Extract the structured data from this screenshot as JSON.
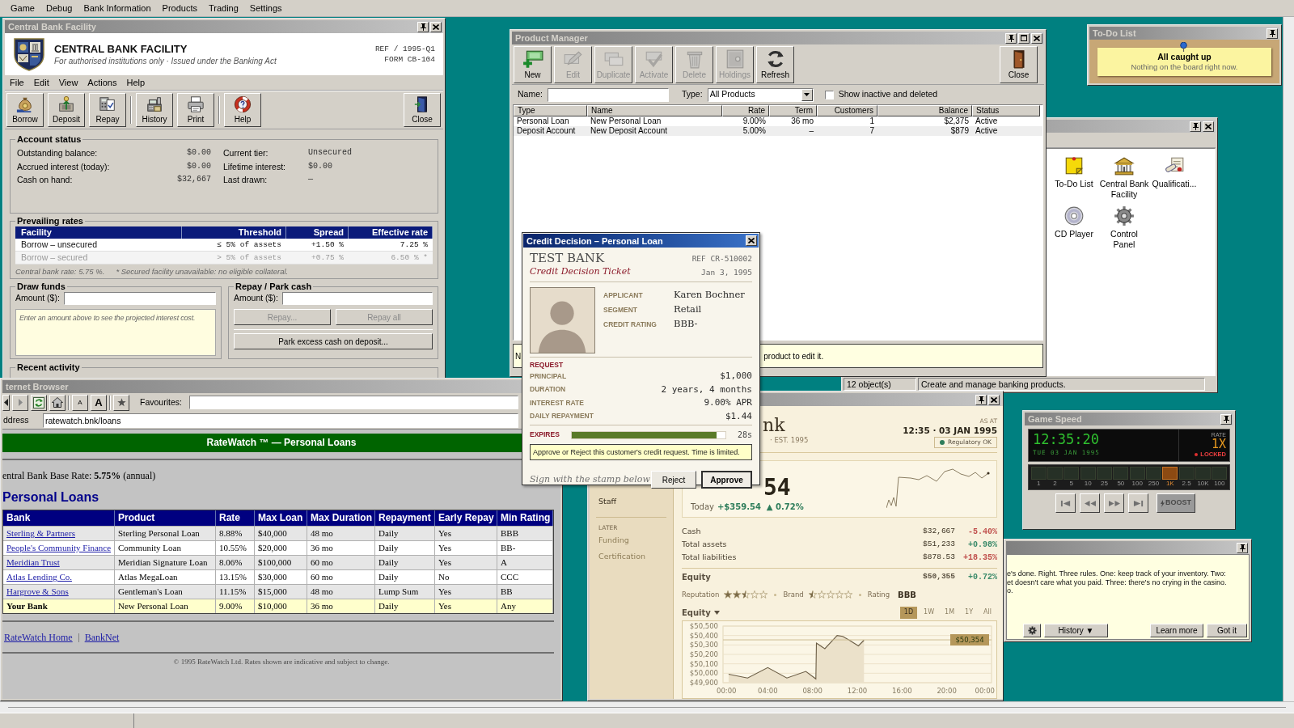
{
  "menu_bar": {
    "items": [
      "Game",
      "Debug",
      "Bank Information",
      "Products",
      "Trading",
      "Settings"
    ]
  },
  "central_bank": {
    "title": "Central Bank Facility",
    "heading": "CENTRAL BANK FACILITY",
    "subheading": "For authorised institutions only · Issued under the Banking Act",
    "ref": "REF / 1995-Q1",
    "form": "FORM CB-104",
    "menu": [
      "File",
      "Edit",
      "View",
      "Actions",
      "Help"
    ],
    "toolbar_groups": [
      [
        "Borrow",
        "Deposit",
        "Repay"
      ],
      [
        "History",
        "Print"
      ],
      [
        "Help"
      ]
    ],
    "close_button": "Close",
    "account_status": {
      "title": "Account status",
      "left": [
        {
          "label": "Outstanding balance:",
          "value": "$0.00"
        },
        {
          "label": "Accrued interest (today):",
          "value": "$0.00"
        },
        {
          "label": "Cash on hand:",
          "value": "$32,667"
        }
      ],
      "right": [
        {
          "label": "Current tier:",
          "value": "Unsecured"
        },
        {
          "label": "Lifetime interest:",
          "value": "$0.00"
        },
        {
          "label": "Last drawn:",
          "value": "—"
        }
      ]
    },
    "rates": {
      "title": "Prevailing rates",
      "columns": [
        "Facility",
        "Threshold",
        "Spread",
        "Effective rate"
      ],
      "rows": [
        {
          "cells": [
            "Borrow – unsecured",
            "≤ 5% of assets",
            "+1.50 %",
            "7.25 %"
          ],
          "disabled": false
        },
        {
          "cells": [
            "Borrow – secured",
            "> 5% of assets",
            "+0.75 %",
            "6.50 % *"
          ],
          "disabled": true
        }
      ],
      "notes": [
        "Central bank rate: 5.75 %.",
        "* Secured facility unavailable: no eligible collateral."
      ]
    },
    "draw_funds": {
      "title": "Draw funds",
      "amount_label": "Amount ($):",
      "hint": "Enter an amount above to see the projected interest cost."
    },
    "repay": {
      "title": "Repay / Park cash",
      "amount_label": "Amount ($):",
      "buttons": [
        {
          "label": "Repay...",
          "disabled": true
        },
        {
          "label": "Repay all",
          "disabled": true
        }
      ],
      "park_button": {
        "label": "Park excess cash on deposit...",
        "disabled": false
      }
    },
    "recent_activity": {
      "title": "Recent activity"
    }
  },
  "product_manager": {
    "title": "Product Manager",
    "toolbar": [
      {
        "label": "New",
        "disabled": false
      },
      {
        "label": "Edit",
        "disabled": true
      },
      {
        "label": "Duplicate",
        "disabled": true
      },
      {
        "label": "Activate",
        "disabled": true
      },
      {
        "label": "Delete",
        "disabled": true
      },
      {
        "label": "Holdings",
        "disabled": true
      },
      {
        "label": "Refresh",
        "disabled": false
      }
    ],
    "close_button": "Close",
    "filter": {
      "name_label": "Name:",
      "type_label": "Type:",
      "type_value": "All Products",
      "show_inactive": {
        "label": "Show inactive and deleted",
        "checked": false
      }
    },
    "columns": [
      "Type",
      "Name",
      "Rate",
      "Term",
      "Customers",
      "Balance",
      "Status"
    ],
    "rows": [
      [
        "Personal Loan",
        "New Personal Loan",
        "9.00%",
        "36 mo",
        "1",
        "$2,375",
        "Active"
      ],
      [
        "Deposit Account",
        "New Deposit Account",
        "5.00%",
        "–",
        "7",
        "$879",
        "Active"
      ]
    ],
    "hint": {
      "visible_start": "N",
      "visible_end": "product to edit it."
    }
  },
  "folder_window": {
    "icons": [
      "To-Do List",
      "Central Bank Facility",
      "Qualificati...",
      "CD Player",
      "Control Panel"
    ],
    "status": [
      "12 object(s)",
      "Create and manage banking products."
    ]
  },
  "todo": {
    "title": "To-Do List",
    "note_title": "All caught up",
    "note_text": "Nothing on the board right now."
  },
  "browser": {
    "title": "ternet Browser",
    "font_buttons": [
      "A",
      "A"
    ],
    "favourites_label": "Favourites:",
    "address_label": "ddress",
    "address": "ratewatch.bnk/loans",
    "banner": "RateWatch ™ — Personal Loans",
    "base_rate": "entral Bank Base Rate: **5.75%** (annual)",
    "heading": "Personal Loans",
    "columns": [
      "Bank",
      "Product",
      "Rate",
      "Max Loan",
      "Max Duration",
      "Repayment",
      "Early Repay",
      "Min Rating"
    ],
    "rows": [
      {
        "cells": [
          "Sterling & Partners",
          "Sterling Personal Loan",
          "8.88%",
          "$40,000",
          "48 mo",
          "Daily",
          "Yes",
          "BBB"
        ],
        "highlighted": false
      },
      {
        "cells": [
          "People's Community Finance",
          "Community Loan",
          "10.55%",
          "$20,000",
          "36 mo",
          "Daily",
          "Yes",
          "BB-"
        ],
        "highlighted": false
      },
      {
        "cells": [
          "Meridian Trust",
          "Meridian Signature Loan",
          "8.06%",
          "$100,000",
          "60 mo",
          "Daily",
          "Yes",
          "A"
        ],
        "highlighted": false
      },
      {
        "cells": [
          "Atlas Lending Co.",
          "Atlas MegaLoan",
          "13.15%",
          "$30,000",
          "60 mo",
          "Daily",
          "No",
          "CCC"
        ],
        "highlighted": false
      },
      {
        "cells": [
          "Hargrove & Sons",
          "Gentleman's Loan",
          "11.15%",
          "$15,000",
          "48 mo",
          "Lump Sum",
          "Yes",
          "BB"
        ],
        "highlighted": false
      },
      {
        "cells": [
          "Your Bank",
          "New Personal Loan",
          "9.00%",
          "$10,000",
          "36 mo",
          "Daily",
          "Yes",
          "Any"
        ],
        "highlighted": true
      }
    ],
    "footer_links": [
      "RateWatch Home",
      "BankNet"
    ],
    "copyright": "© 1995 RateWatch Ltd. Rates shown are indicative and subject to change."
  },
  "credit_decision": {
    "title": "Credit Decision – Personal Loan",
    "bank": "TEST BANK",
    "ticket": "Credit Decision Ticket",
    "ref": "REF CR-510002",
    "date": "Jan 3, 1995",
    "applicant": [
      {
        "label": "APPLICANT",
        "value": "Karen Bochner"
      },
      {
        "label": "SEGMENT",
        "value": "Retail"
      },
      {
        "label": "CREDIT RATING",
        "value": "BBB-"
      }
    ],
    "request_title": "REQUEST",
    "request": [
      {
        "label": "PRINCIPAL",
        "value": "$1,000"
      },
      {
        "label": "DURATION",
        "value": "2 years, 4 months"
      },
      {
        "label": "INTEREST RATE",
        "value": "9.00% APR"
      },
      {
        "label": "DAILY REPAYMENT",
        "value": "$1.44"
      }
    ],
    "expires": {
      "label": "EXPIRES",
      "level": 0.94,
      "remaining": "28s"
    },
    "instruction": "Approve or Reject this customer's credit request. Time is limited.",
    "sign_hint": "Sign with the stamp below",
    "buttons": [
      {
        "label": "Reject",
        "default": false
      },
      {
        "label": "Approve",
        "default": true
      }
    ]
  },
  "dashboard": {
    "name_fragment": "nk",
    "subtitle_fragment": "· EST. 1995",
    "as_at_label": "AS AT",
    "as_at": "12:35 · 03 JAN 1995",
    "status": "Regulatory OK",
    "equity_fragment": "54",
    "today": {
      "label": "Today",
      "change": "+$359.54",
      "percent": "▲ 0.72%"
    },
    "sidebar": [
      {
        "kind": "item",
        "label": "Staff",
        "disabled": false
      },
      {
        "kind": "header",
        "label": "LATER"
      },
      {
        "kind": "item",
        "label": "Funding",
        "disabled": true
      },
      {
        "kind": "item",
        "label": "Certification",
        "disabled": true
      }
    ],
    "metrics": [
      {
        "label": "Cash",
        "value": "$32,667",
        "change": "-5.40%",
        "color": "#c0504d"
      },
      {
        "label": "Total assets",
        "value": "$51,233",
        "change": "+0.98%",
        "color": "#3a8a6a"
      },
      {
        "label": "Total liabilities",
        "value": "$878.53",
        "change": "+18.35%",
        "color": "#c0504d"
      }
    ],
    "equity": {
      "label": "Equity",
      "value": "$50,355",
      "change": "+0.72%",
      "color": "#3a8a6a"
    },
    "scores": [
      {
        "label": "Reputation",
        "stars": 2.5
      },
      {
        "label": "Brand",
        "stars": 0.5
      }
    ],
    "rating": {
      "label": "Rating",
      "value": "BBB"
    },
    "chart": {
      "ranges": [
        {
          "label": "1D",
          "selected": true
        },
        {
          "label": "1W",
          "selected": false
        },
        {
          "label": "1M",
          "selected": false
        },
        {
          "label": "1Y",
          "selected": false
        },
        {
          "label": "All",
          "selected": false
        }
      ],
      "chart_data": {
        "type": "area",
        "x": [
          0.5,
          2.2,
          4,
          5.7,
          7.4,
          8.3,
          8.35,
          9.1,
          10.2,
          10.7,
          11.3,
          12.1,
          12.6
        ],
        "series": [
          {
            "name": "Equity",
            "color": "#6b5d45",
            "values": [
              49990,
              49950,
              50060,
              49950,
              50020,
              49940,
              50320,
              50260,
              50400,
              50390,
              50350,
              50290,
              50350
            ]
          }
        ],
        "xlim": [
          0,
          24
        ],
        "ylim": [
          49900,
          50500
        ],
        "xticks": [
          {
            "value": 0,
            "label": "00:00"
          },
          {
            "value": 4,
            "label": "04:00"
          },
          {
            "value": 8,
            "label": "08:00"
          },
          {
            "value": 12,
            "label": "12:00"
          },
          {
            "value": 16,
            "label": "16:00"
          },
          {
            "value": 20,
            "label": "20:00"
          },
          {
            "value": 24,
            "label": "00:00"
          }
        ],
        "yticks": [
          {
            "value": 49900,
            "label": "$49,900"
          },
          {
            "value": 50000,
            "label": "$50,000"
          },
          {
            "value": 50100,
            "label": "$50,100"
          },
          {
            "value": 50200,
            "label": "$50,200"
          },
          {
            "value": 50300,
            "label": "$50,300"
          },
          {
            "value": 50400,
            "label": "$50,400"
          },
          {
            "value": 50500,
            "label": "$50,500"
          }
        ],
        "grid": true,
        "ref_lines": [
          {
            "axis": "y",
            "value": 50354,
            "label": "$50,354"
          }
        ]
      }
    }
  },
  "game_speed": {
    "title": "Game Speed",
    "time": "12:35:20",
    "date": "TUE 03 JAN 1995",
    "rate_label": "RATE",
    "rate": "1X",
    "lock": "LOCKED",
    "speeds": [
      {
        "label": "1",
        "selected": false
      },
      {
        "label": "2",
        "selected": false
      },
      {
        "label": "5",
        "selected": false
      },
      {
        "label": "10",
        "selected": false
      },
      {
        "label": "25",
        "selected": false
      },
      {
        "label": "50",
        "selected": false
      },
      {
        "label": "100",
        "selected": false
      },
      {
        "label": "250",
        "selected": false
      },
      {
        "label": "1K",
        "selected": true
      },
      {
        "label": "2.5",
        "selected": false
      },
      {
        "label": "10K",
        "selected": false
      },
      {
        "label": "100",
        "selected": false
      }
    ],
    "boost": {
      "label": "BOOST",
      "disabled": true
    }
  },
  "tip": {
    "text": "e's done. Right. Three rules. One: keep track of your inventory. Two:\net doesn't care what you paid. Three: there's no crying in the casino.\no.",
    "buttons": [
      "History ▼",
      "Learn more",
      "Got it"
    ]
  }
}
